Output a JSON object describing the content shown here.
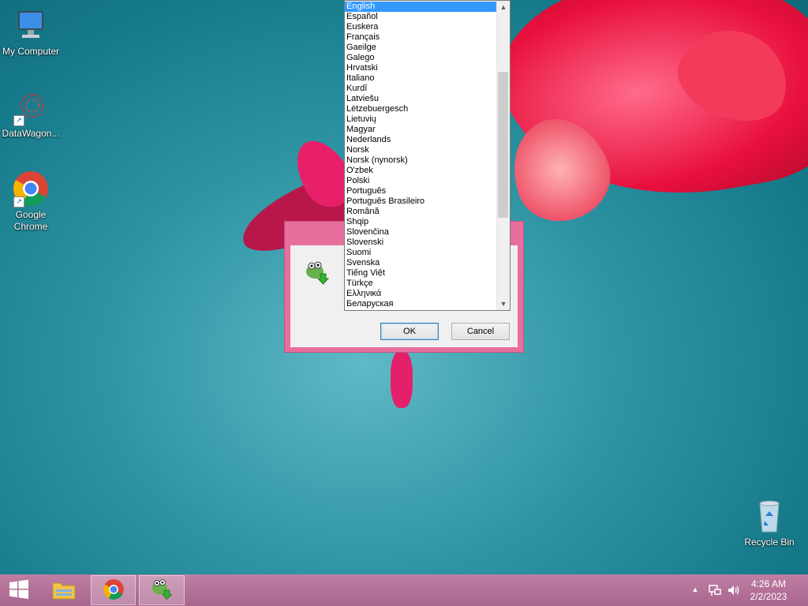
{
  "desktop": {
    "icons": [
      {
        "label": "My Computer"
      },
      {
        "label": "DataWagon..."
      },
      {
        "label": "Google Chrome"
      },
      {
        "label": "Recycle Bin"
      }
    ]
  },
  "dialog": {
    "ok_label": "OK",
    "cancel_label": "Cancel",
    "selected_language": "English",
    "languages": [
      "English",
      "Español",
      "Euskera",
      "Français",
      "Gaeilge",
      "Galego",
      "Hrvatski",
      "Italiano",
      "Kurdî",
      "Latviešu",
      "Lëtzebuergesch",
      "Lietuvių",
      "Magyar",
      "Nederlands",
      "Norsk",
      "Norsk (nynorsk)",
      "O'zbek",
      "Polski",
      "Português",
      "Português Brasileiro",
      "Română",
      "Shqip",
      "Slovenčina",
      "Slovenski",
      "Suomi",
      "Svenska",
      "Tiếng Việt",
      "Türkçe",
      "Ελληνικά",
      "Беларуская"
    ]
  },
  "taskbar": {
    "time": "4:26 AM",
    "date": "2/2/2023"
  },
  "icons": {
    "start": "windows-start-icon",
    "explorer": "file-explorer-icon",
    "chrome": "chrome-icon",
    "installer": "installer-chameleon-icon",
    "tray_up": "show-hidden-icons-icon",
    "network": "network-icon",
    "volume": "volume-icon"
  },
  "colors": {
    "dialog_frame": "#e76f9d",
    "taskbar": "#b0709a",
    "selection": "#3399ff"
  }
}
